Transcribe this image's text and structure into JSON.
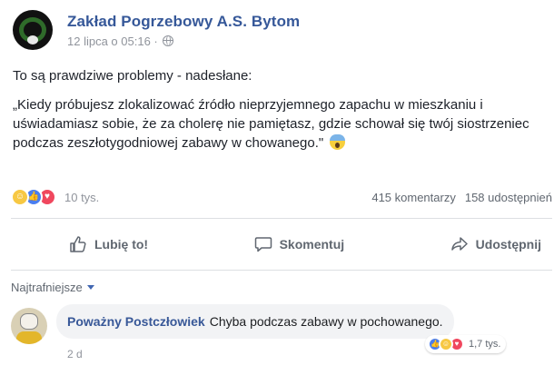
{
  "post": {
    "page_name": "Zakład Pogrzebowy A.S. Bytom",
    "timestamp": "12 lipca o 05:16 ·",
    "intro": "To są prawdziwe problemy - nadesłane:",
    "quote": "„Kiedy próbujesz zlokalizować źródło nieprzyjemnego zapachu w mieszkaniu i uświadamiasz sobie, że za cholerę nie pamiętasz, gdzie schował się twój siostrzeniec podczas zeszłotygodniowej zabawy w chowanego.\"",
    "quote_emoji": "face-screaming-in-fear"
  },
  "reactions": {
    "icons": [
      "haha",
      "like",
      "love"
    ],
    "count": "10 tys.",
    "comments": "415 komentarzy",
    "shares": "158 udostępnień"
  },
  "actions": {
    "like_label": "Lubię to!",
    "comment_label": "Skomentuj",
    "share_label": "Udostępnij"
  },
  "comments_section": {
    "sort_label": "Najtrafniejsze",
    "comments": [
      {
        "author": "Poważny Postczłowiek",
        "text": "Chyba podczas zabawy w pochowanego.",
        "reaction_icons": [
          "like",
          "haha",
          "love"
        ],
        "reaction_count": "1,7 tys.",
        "time": "2 d"
      }
    ]
  },
  "colors": {
    "link_blue": "#365899",
    "meta_gray": "#90949c",
    "like_blue": "#4a7ef0",
    "love_red": "#f0475e",
    "haha_yellow": "#f7c843"
  }
}
